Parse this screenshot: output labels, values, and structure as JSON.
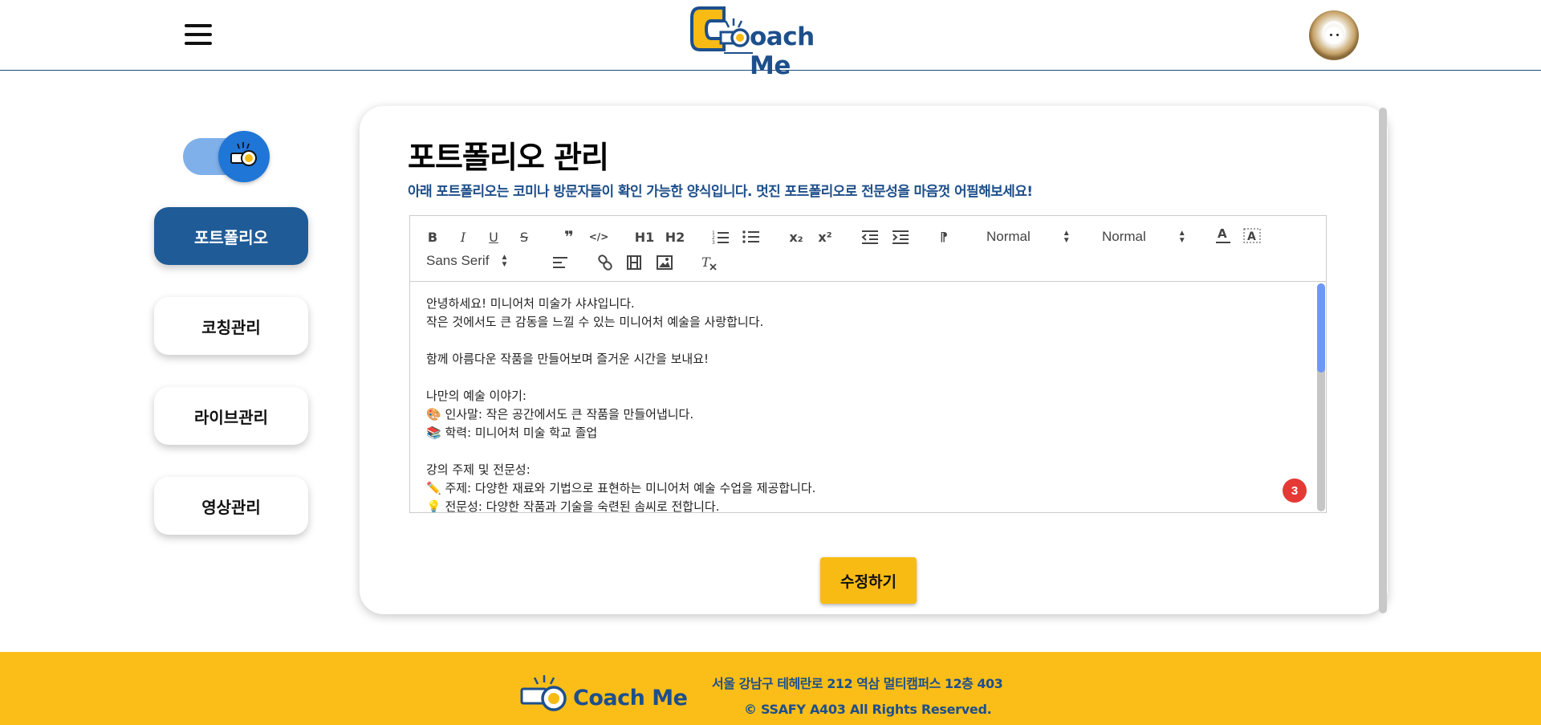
{
  "header": {
    "logo_text": "oach Me",
    "menu_icon": "hamburger-icon",
    "avatar_icon": "profile-avatar"
  },
  "sidebar": {
    "toggle_icon": "whistle-icon",
    "items": [
      {
        "label": "포트폴리오",
        "active": true
      },
      {
        "label": "코칭관리",
        "active": false
      },
      {
        "label": "라이브관리",
        "active": false
      },
      {
        "label": "영상관리",
        "active": false
      }
    ]
  },
  "main": {
    "title": "포트폴리오 관리",
    "subtitle": "아래 포트폴리오는 코미나 방문자들이 확인 가능한 양식입니다. 멋진 포트폴리오로 전문성을 마음껏 어필해보세요!",
    "save_button": "수정하기"
  },
  "editor": {
    "toolbar": {
      "bold": "B",
      "italic": "I",
      "underline": "U",
      "strike": "S",
      "blockquote": "❞",
      "code": "</>",
      "h1": "H1",
      "h2": "H2",
      "subscript": "x₂",
      "superscript": "x²",
      "direction": "⁋",
      "size_select": "Normal",
      "header_select": "Normal",
      "font_select": "Sans Serif"
    },
    "lines": [
      "안녕하세요! 미니어처 미술가 샤샤입니다.",
      "작은 것에서도 큰 감동을 느낄 수 있는 미니어처 예술을 사랑합니다.",
      "",
      "함께 아름다운 작품을 만들어보며 즐거운 시간을 보내요!",
      "",
      "나만의 예술 이야기:",
      "🎨 인사말: 작은 공간에서도 큰 작품을 만들어냅니다.",
      "📚 학력: 미니어처 미술 학교 졸업",
      "",
      "강의 주제 및 전문성:",
      "✏️ 주제: 다양한 재료와 기법으로 표현하는 미니어처 예술 수업을 제공합니다.",
      "💡 전문성: 다양한 작품과 기술을 숙련된 솜씨로 전합니다."
    ],
    "badge_count": "3"
  },
  "footer": {
    "logo_text": "Coach Me",
    "address": "서울 강남구 테헤란로 212 역삼 멀티캠퍼스 12층 403",
    "copyright": "© SSAFY A403 All Rights Reserved."
  },
  "colors": {
    "brand_blue": "#1d4f8c",
    "accent_yellow": "#fbbe18",
    "active_tab": "#1f5b97"
  }
}
